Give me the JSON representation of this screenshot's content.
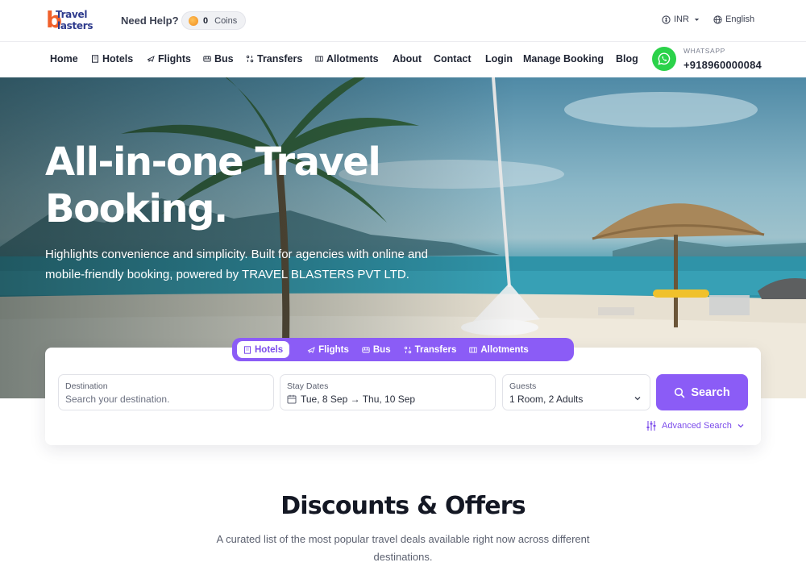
{
  "brand": {
    "logo_mark": "b",
    "logo_word1": "Travel",
    "logo_word2": "lasters"
  },
  "topbar": {
    "need_help": "Need Help?",
    "coins_count": "0",
    "coins_label": "Coins",
    "currency": "INR",
    "language": "English"
  },
  "nav": {
    "items": [
      "Home",
      "Hotels",
      "Flights",
      "Bus",
      "Transfers",
      "Allotments",
      "About",
      "Contact",
      "Login",
      "Manage Booking",
      "Blog"
    ],
    "whatsapp_label": "WHATSAPP",
    "whatsapp_number": "+918960000084"
  },
  "hero": {
    "title_line1": "All-in-one Travel",
    "title_line2": "Booking.",
    "subtitle": "Highlights convenience and simplicity. Built for agencies with online and mobile-friendly booking, powered by TRAVEL BLASTERS PVT LTD."
  },
  "search": {
    "tabs": [
      "Hotels",
      "Flights",
      "Bus",
      "Transfers",
      "Allotments"
    ],
    "active_tab": "Hotels",
    "destination_label": "Destination",
    "destination_placeholder": "Search your destination.",
    "dates_label": "Stay Dates",
    "dates_value": "Tue, 8 Sep → Thu, 10 Sep",
    "guests_label": "Guests",
    "guests_value": "1 Room, 2 Adults",
    "search_button": "Search",
    "advanced_search": "Advanced Search"
  },
  "discounts": {
    "title": "Discounts & Offers",
    "subtitle": "A curated list of the most popular travel deals available right now across different destinations."
  },
  "colors": {
    "accent": "#8b5cf6",
    "whatsapp": "#2bd24a",
    "logo_orange": "#f0602b",
    "logo_navy": "#2d3a8c"
  }
}
